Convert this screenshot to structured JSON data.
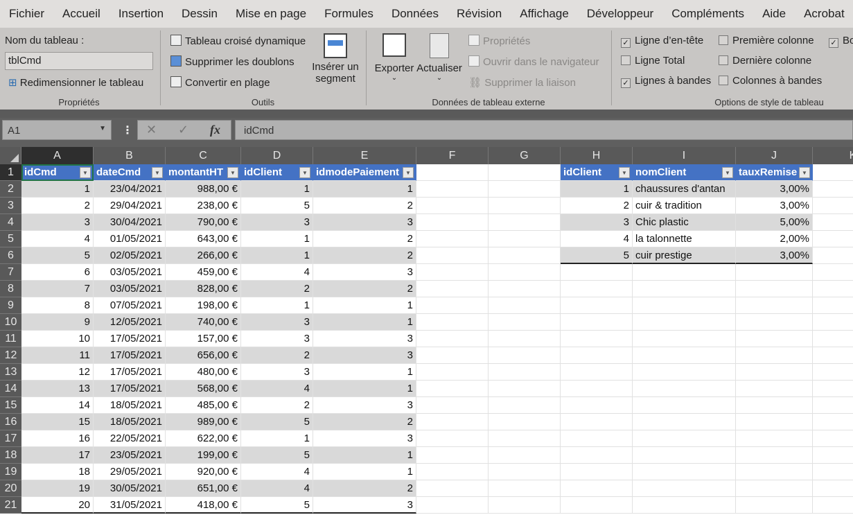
{
  "menu": [
    "Fichier",
    "Accueil",
    "Insertion",
    "Dessin",
    "Mise en page",
    "Formules",
    "Données",
    "Révision",
    "Affichage",
    "Développeur",
    "Compléments",
    "Aide",
    "Acrobat"
  ],
  "ribbon": {
    "props": {
      "name_label": "Nom du tableau :",
      "name_value": "tblCmd",
      "resize": "Redimensionner le tableau",
      "group": "Propriétés"
    },
    "tools": {
      "pivot": "Tableau croisé dynamique",
      "dedupe": "Supprimer les doublons",
      "convert": "Convertir en plage",
      "slicer1": "Insérer un",
      "slicer2": "segment",
      "group": "Outils"
    },
    "external": {
      "export": "Exporter",
      "refresh": "Actualiser",
      "properties": "Propriétés",
      "open_browser": "Ouvrir dans le navigateur",
      "unlink": "Supprimer la liaison",
      "group": "Données de tableau externe"
    },
    "style": {
      "options": [
        {
          "label": "Ligne d’en-tête",
          "checked": true
        },
        {
          "label": "Ligne Total",
          "checked": false
        },
        {
          "label": "Lignes à bandes",
          "checked": true
        },
        {
          "label": "Première colonne",
          "checked": false
        },
        {
          "label": "Dernière colonne",
          "checked": false
        },
        {
          "label": "Colonnes à bandes",
          "checked": false
        },
        {
          "label": "Bo",
          "checked": true
        }
      ],
      "group": "Options de style de tableau"
    }
  },
  "formula": {
    "namebox": "A1",
    "value": "idCmd",
    "fx": "fx"
  },
  "columns": [
    "A",
    "B",
    "C",
    "D",
    "E",
    "F",
    "G",
    "H",
    "I",
    "J",
    "K"
  ],
  "tblCmd": {
    "headers": [
      "idCmd",
      "dateCmd",
      "montantHT",
      "idClient",
      "idmodePaiement"
    ],
    "rows": [
      [
        "1",
        "23/04/2021",
        "988,00 €",
        "1",
        "1"
      ],
      [
        "2",
        "29/04/2021",
        "238,00 €",
        "5",
        "2"
      ],
      [
        "3",
        "30/04/2021",
        "790,00 €",
        "3",
        "3"
      ],
      [
        "4",
        "01/05/2021",
        "643,00 €",
        "1",
        "2"
      ],
      [
        "5",
        "02/05/2021",
        "266,00 €",
        "1",
        "2"
      ],
      [
        "6",
        "03/05/2021",
        "459,00 €",
        "4",
        "3"
      ],
      [
        "7",
        "03/05/2021",
        "828,00 €",
        "2",
        "2"
      ],
      [
        "8",
        "07/05/2021",
        "198,00 €",
        "1",
        "1"
      ],
      [
        "9",
        "12/05/2021",
        "740,00 €",
        "3",
        "1"
      ],
      [
        "10",
        "17/05/2021",
        "157,00 €",
        "3",
        "3"
      ],
      [
        "11",
        "17/05/2021",
        "656,00 €",
        "2",
        "3"
      ],
      [
        "12",
        "17/05/2021",
        "480,00 €",
        "3",
        "1"
      ],
      [
        "13",
        "17/05/2021",
        "568,00 €",
        "4",
        "1"
      ],
      [
        "14",
        "18/05/2021",
        "485,00 €",
        "2",
        "3"
      ],
      [
        "15",
        "18/05/2021",
        "989,00 €",
        "5",
        "2"
      ],
      [
        "16",
        "22/05/2021",
        "622,00 €",
        "1",
        "3"
      ],
      [
        "17",
        "23/05/2021",
        "199,00 €",
        "5",
        "1"
      ],
      [
        "18",
        "29/05/2021",
        "920,00 €",
        "4",
        "1"
      ],
      [
        "19",
        "30/05/2021",
        "651,00 €",
        "4",
        "2"
      ],
      [
        "20",
        "31/05/2021",
        "418,00 €",
        "5",
        "3"
      ]
    ]
  },
  "tblClient": {
    "headers": [
      "idClient",
      "nomClient",
      "tauxRemise"
    ],
    "rows": [
      [
        "1",
        "chaussures d'antan",
        "3,00%"
      ],
      [
        "2",
        "cuir & tradition",
        "3,00%"
      ],
      [
        "3",
        "Chic plastic",
        "5,00%"
      ],
      [
        "4",
        "la talonnette",
        "2,00%"
      ],
      [
        "5",
        "cuir prestige",
        "3,00%"
      ]
    ]
  },
  "colors": {
    "header": "#4472c4",
    "band": "#d9d9d9"
  }
}
